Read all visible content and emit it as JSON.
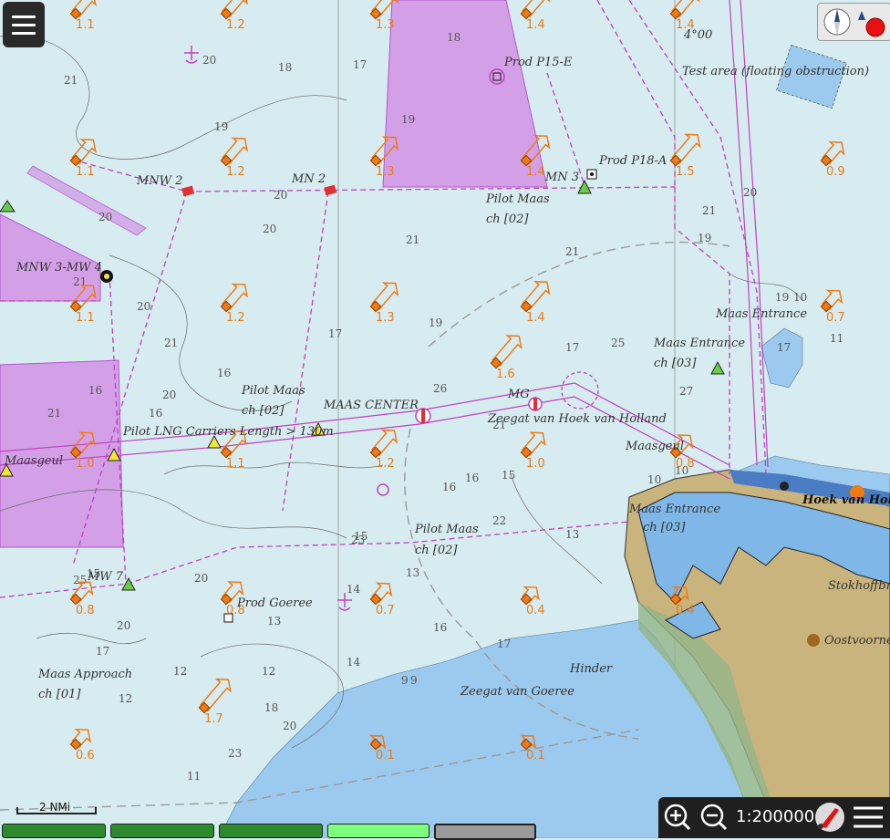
{
  "map": {
    "labels": [
      {
        "text": "Test area (floating obstruction)",
        "id": "test-area"
      },
      {
        "text": "Prod P15-E",
        "id": "prod-p15e"
      },
      {
        "text": "Prod P18-A",
        "id": "prod-p18a"
      },
      {
        "text": "MNW 2",
        "id": "mnw2"
      },
      {
        "text": "MN 2",
        "id": "mn2"
      },
      {
        "text": "MN 3",
        "id": "mn3"
      },
      {
        "text": "Pilot Maas",
        "id": "pilot1"
      },
      {
        "text": "ch [02]",
        "id": "pilot1ch"
      },
      {
        "text": "MNW 3-MW 4",
        "id": "mnw3"
      },
      {
        "text": "Maas Entrance",
        "id": "maasent1"
      },
      {
        "text": "Maas Entrance",
        "id": "maasent2"
      },
      {
        "text": "ch [03]",
        "id": "maasent2ch"
      },
      {
        "text": "Pilot Maas",
        "id": "pilot2"
      },
      {
        "text": "ch [02]",
        "id": "pilot2ch"
      },
      {
        "text": "MAAS CENTER",
        "id": "maascenter"
      },
      {
        "text": "MG",
        "id": "mg"
      },
      {
        "text": "Zeegat van Hoek van Holland",
        "id": "zeegathvh"
      },
      {
        "text": "Pilot LNG Carriers Length > 130m",
        "id": "pilotlng"
      },
      {
        "text": "Maasgeul",
        "id": "maasgeul"
      },
      {
        "text": "Maas Entrance",
        "id": "maasent3"
      },
      {
        "text": "ch [03]",
        "id": "maasent3ch"
      },
      {
        "text": "Hoek van Holland",
        "id": "hvh"
      },
      {
        "text": "Pilot Maas",
        "id": "pilot3"
      },
      {
        "text": "ch [02]",
        "id": "pilot3ch"
      },
      {
        "text": "MW 7",
        "id": "mw7"
      },
      {
        "text": "Prod Goeree",
        "id": "prodgoeree"
      },
      {
        "text": "Maas Approach",
        "id": "maasapp"
      },
      {
        "text": "ch [01]",
        "id": "maasappch"
      },
      {
        "text": "Hinder",
        "id": "hinder"
      },
      {
        "text": "Zeegat van Goeree",
        "id": "zeegatgoeree"
      },
      {
        "text": "Oostvoorne",
        "id": "oostvoorne"
      },
      {
        "text": "Stokhoffbrug",
        "id": "stokhoff"
      },
      {
        "text": "Maasgeul",
        "id": "maasgeul2"
      },
      {
        "text": "4°00",
        "id": "lon"
      }
    ],
    "current_arrows": [
      {
        "v": "1.1"
      },
      {
        "v": "1.2"
      },
      {
        "v": "1.3"
      },
      {
        "v": "1.4"
      },
      {
        "v": "1.4"
      },
      {
        "v": "1.1"
      },
      {
        "v": "1.2"
      },
      {
        "v": "1.3"
      },
      {
        "v": "1.4"
      },
      {
        "v": "1.5"
      },
      {
        "v": "0.9"
      },
      {
        "v": "1.1"
      },
      {
        "v": "1.2"
      },
      {
        "v": "1.3"
      },
      {
        "v": "1.4"
      },
      {
        "v": "0.7"
      },
      {
        "v": "1.6"
      },
      {
        "v": "1.0"
      },
      {
        "v": "1.1"
      },
      {
        "v": "1.2"
      },
      {
        "v": "1.0"
      },
      {
        "v": "0.8"
      },
      {
        "v": "0.8"
      },
      {
        "v": "0.8"
      },
      {
        "v": "0.7"
      },
      {
        "v": "0.4"
      },
      {
        "v": "0.4"
      },
      {
        "v": "1.7"
      },
      {
        "v": "0.6"
      },
      {
        "v": "0.1"
      },
      {
        "v": "0.1"
      }
    ],
    "soundings": [
      "18",
      "17",
      "18",
      "20",
      "21",
      "19",
      "19",
      "20",
      "20",
      "20",
      "21",
      "19",
      "21",
      "21",
      "20",
      "21",
      "17",
      "17",
      "16",
      "16",
      "16",
      "21",
      "20",
      "15",
      "20",
      "20",
      "14",
      "13",
      "16",
      "17",
      "12",
      "12",
      "11",
      "9",
      "25",
      "22",
      "23",
      "14",
      "15",
      "16",
      "16",
      "17",
      "18",
      "20",
      "23",
      "21",
      "26",
      "27",
      "25",
      "20",
      "21",
      "19",
      "19",
      "10",
      "10",
      "11",
      "17",
      "10",
      "13",
      "15",
      "13",
      "9",
      "12"
    ]
  },
  "scalebar": {
    "label": "2 NMi"
  },
  "toolbar": {
    "scale": "1:200000"
  },
  "colors": {
    "sea": "#d7ecf0",
    "shallow": "#9cc9ee",
    "land": "#c9b47d",
    "restricted": "#d3a0e8",
    "arrow": "#f07a14",
    "route": "#c23ec2"
  },
  "icons": {
    "menu": "hamburger-icon",
    "compass": "compass-icon",
    "zoom_in": "zoom-in-icon",
    "zoom_out": "zoom-out-icon",
    "route": "route-icon",
    "settings": "menu-lines-icon"
  }
}
